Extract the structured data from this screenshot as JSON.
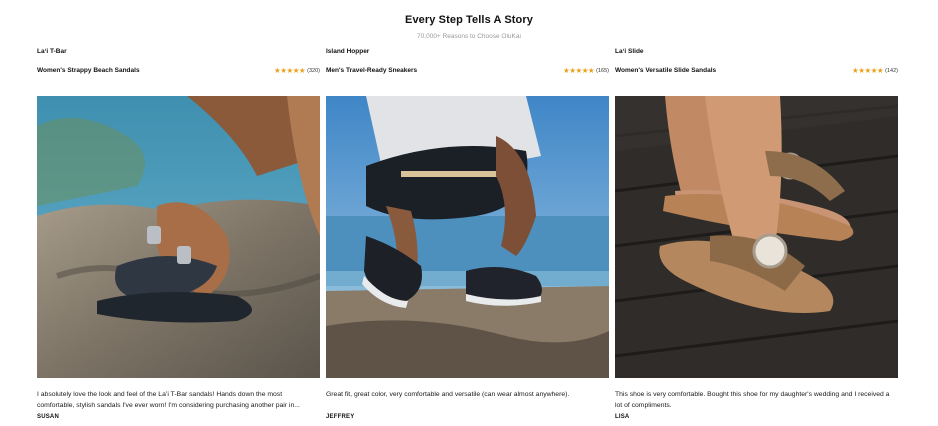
{
  "header": {
    "title": "Every Step Tells A Story",
    "subtitle": "70,000+ Reasons to Choose OluKai"
  },
  "colors": {
    "star": "#e8a21d",
    "text": "#111111"
  },
  "cards": [
    {
      "product_name": "Laʻi T-Bar",
      "product_desc": "Women's Strappy Beach Sandals",
      "stars": "★★★★★",
      "rating_count": "(320)",
      "photo": "woman's feet in dark t-bar sandals on a rocky shore",
      "review": "I absolutely love the look and feel of the Laʻi T-Bar sandals! Hands down the most comfortable, stylish sandals I've ever worn! I'm considering purchasing another pair in...",
      "author": "SUSAN"
    },
    {
      "product_name": "Island Hopper",
      "product_desc": "Men's Travel-Ready Sneakers",
      "stars": "★★★★★",
      "rating_count": "(165)",
      "photo": "man crouching in black sneakers on a beach rock wall",
      "review": "Great fit, great color, very comfortable and versatile (can wear almost anywhere).",
      "author": "JEFFREY"
    },
    {
      "product_name": "Laʻi Slide",
      "product_desc": "Women's Versatile Slide Sandals",
      "stars": "★★★★★",
      "rating_count": "(142)",
      "photo": "feet in tan cross-strap slide sandals on a wooden deck",
      "review": "This shoe is very comfortable. Bought this shoe for my daughter's wedding and I received a lot of compliments.",
      "author": "LISA"
    }
  ]
}
